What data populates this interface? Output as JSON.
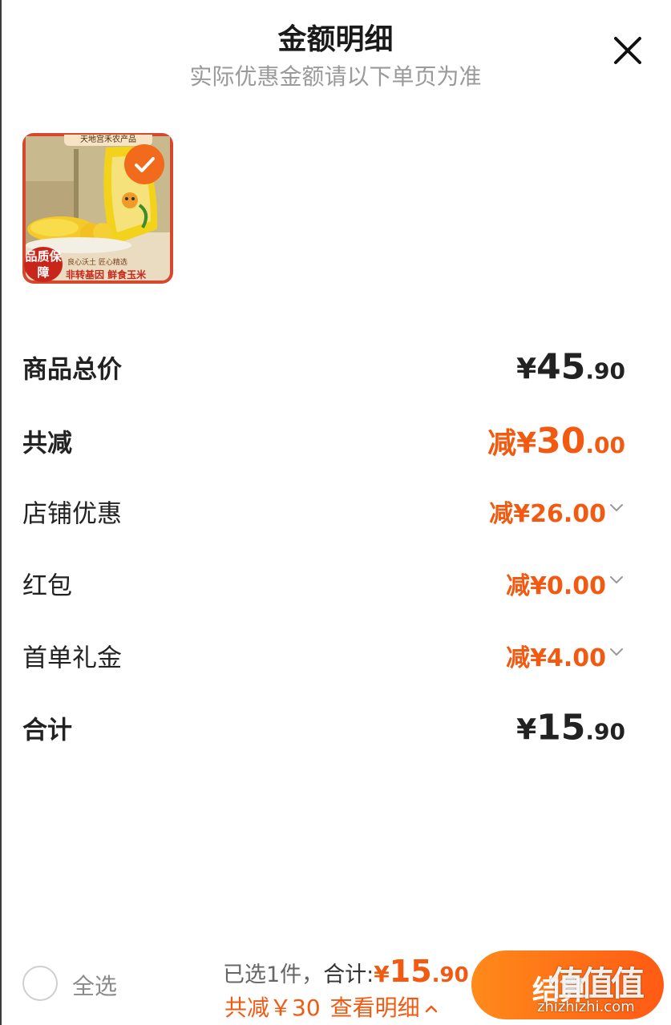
{
  "header": {
    "title": "金额明细",
    "subtitle": "实际优惠金额请以下单页为准",
    "close_icon": "close-icon"
  },
  "product": {
    "thumb_top_tag": "天地宫禾农产品",
    "thumb_badge": "品质保障",
    "thumb_slogan": "良心沃土 匠心精选",
    "thumb_slogan_main": "非转基因 鲜食玉米",
    "selected": true,
    "check_icon": "check-icon"
  },
  "breakdown": {
    "subtotal": {
      "label": "商品总价",
      "currency": "¥",
      "integer": "45",
      "decimal": ".90"
    },
    "total_discount": {
      "label": "共减",
      "prefix": "减¥",
      "integer": "30",
      "decimal": ".00"
    },
    "discounts": [
      {
        "label": "店铺优惠",
        "amount": "减¥26.00",
        "icon": "chevron-down-icon"
      },
      {
        "label": "红包",
        "amount": "减¥0.00",
        "icon": "chevron-down-icon"
      },
      {
        "label": "首单礼金",
        "amount": "减¥4.00",
        "icon": "chevron-down-icon"
      }
    ],
    "total": {
      "label": "合计",
      "currency": "¥",
      "integer": "15",
      "decimal": ".90"
    }
  },
  "footer": {
    "select_all_label": "全选",
    "selected_text": "已选1件，",
    "total_label": "合计:",
    "total_currency": "¥",
    "total_integer": "15",
    "total_decimal": ".90",
    "discount_text": "共减￥30",
    "view_detail": "查看明细",
    "view_detail_icon": "chevron-up-icon",
    "checkout_label": "结算"
  },
  "watermark": {
    "logo": "值值值",
    "site": "zhizhizhi.com"
  },
  "colors": {
    "accent": "#f25a12",
    "button_gradient_start": "#ff8a1a",
    "button_gradient_end": "#ff5a14",
    "subtitle": "#9a9a9a"
  }
}
